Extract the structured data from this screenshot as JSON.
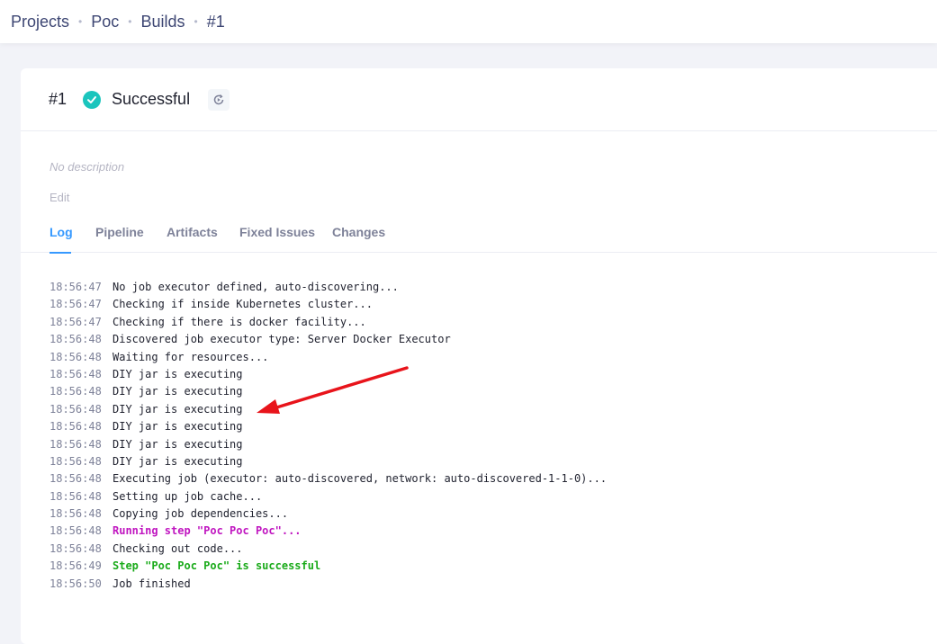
{
  "breadcrumbs": [
    "Projects",
    "Poc",
    "Builds",
    "#1"
  ],
  "build": {
    "number": "#1",
    "status": "Successful",
    "description": "No description",
    "edit_label": "Edit"
  },
  "icons": {
    "status": "check-circle-icon",
    "rebuild": "rebuild-icon"
  },
  "colors": {
    "accent": "#3699ff",
    "success": "#1bc5bd",
    "log_step": "#c016c0",
    "log_success": "#1bab1b",
    "annotation_arrow": "#e8141b"
  },
  "tabs": [
    "Log",
    "Pipeline",
    "Artifacts",
    "Fixed Issues",
    "Changes"
  ],
  "active_tab": "Log",
  "log": [
    {
      "time": "18:56:47",
      "text": "No job executor defined, auto-discovering..."
    },
    {
      "time": "18:56:47",
      "text": "Checking if inside Kubernetes cluster..."
    },
    {
      "time": "18:56:47",
      "text": "Checking if there is docker facility..."
    },
    {
      "time": "18:56:48",
      "text": "Discovered job executor type: Server Docker Executor"
    },
    {
      "time": "18:56:48",
      "text": "Waiting for resources..."
    },
    {
      "time": "18:56:48",
      "text": "DIY jar is executing"
    },
    {
      "time": "18:56:48",
      "text": "DIY jar is executing"
    },
    {
      "time": "18:56:48",
      "text": "DIY jar is executing"
    },
    {
      "time": "18:56:48",
      "text": "DIY jar is executing"
    },
    {
      "time": "18:56:48",
      "text": "DIY jar is executing"
    },
    {
      "time": "18:56:48",
      "text": "DIY jar is executing"
    },
    {
      "time": "18:56:48",
      "text": "Executing job (executor: auto-discovered, network: auto-discovered-1-1-0)..."
    },
    {
      "time": "18:56:48",
      "text": "Setting up job cache..."
    },
    {
      "time": "18:56:48",
      "text": "Copying job dependencies..."
    },
    {
      "time": "18:56:48",
      "text": "Running step \"Poc Poc Poc\"...",
      "style": "purple"
    },
    {
      "time": "18:56:48",
      "text": "Checking out code..."
    },
    {
      "time": "18:56:49",
      "text": "Step \"Poc Poc Poc\" is successful",
      "style": "green"
    },
    {
      "time": "18:56:50",
      "text": "Job finished"
    }
  ]
}
